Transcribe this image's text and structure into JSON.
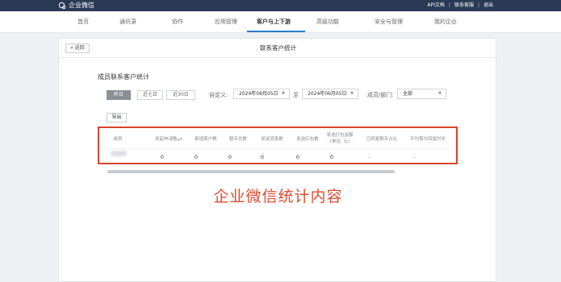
{
  "topbar": {
    "logo": "企业微信",
    "links": [
      "API文档",
      "联系客服",
      "退出"
    ]
  },
  "nav": {
    "items": [
      "首页",
      "通讯录",
      "协作",
      "应用管理",
      "客户与上下游",
      "高级功能",
      "安全与管理",
      "我的企业"
    ],
    "active_index": 4
  },
  "page": {
    "back_label": "« 返回",
    "title": "联系客户统计"
  },
  "stats": {
    "section_title": "成员联系客户统计",
    "range_tabs": [
      "昨日",
      "近七日",
      "近30日"
    ],
    "active_range": 0,
    "custom_label": "自定义:",
    "start_date": "2024年06月05日",
    "to_label": "至",
    "end_date": "2024年06月05日",
    "member_label": "成员/部门:",
    "member_value": "全部",
    "export_label": "导出"
  },
  "table": {
    "headers": [
      "成员",
      "发起申请数",
      "新增客户数",
      "聊天总数",
      "发送消息数",
      "发送红包数",
      "发送打包金额(单位: 元)",
      "已回复聊天占比",
      "平均首次回复时长"
    ],
    "row": [
      "0",
      "0",
      "0",
      "0",
      "0",
      "0",
      "--",
      "--"
    ]
  },
  "annotation": "企业微信统计内容"
}
